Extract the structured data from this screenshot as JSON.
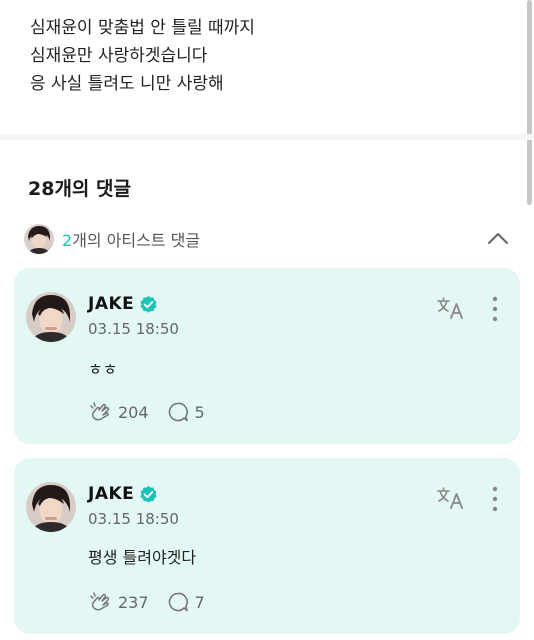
{
  "post": {
    "lines": [
      "심재윤이 맞춤법 안 틀릴 때까지",
      "심재윤만 사랑하겟습니다",
      "응 사실 틀려도 니만 사랑해"
    ]
  },
  "comments_header": {
    "count_label": "28개의 댓글"
  },
  "artist_comments": {
    "count": "2",
    "label_suffix": "개의 아티스트 댓글"
  },
  "comments": [
    {
      "author": "JAKE",
      "date": "03.15 18:50",
      "text": "ㅎㅎ",
      "likes": "204",
      "replies": "5"
    },
    {
      "author": "JAKE",
      "date": "03.15 18:50",
      "text": "평생 틀려야겟다",
      "likes": "237",
      "replies": "7"
    }
  ],
  "colors": {
    "accent": "#1ec0ba",
    "card_bg": "#e3f7f4"
  },
  "icons": {
    "verified": "verified-badge-icon",
    "translate": "translate-icon",
    "more": "more-vertical-icon",
    "like": "cheer-hand-icon",
    "reply": "speech-bubble-icon",
    "collapse": "chevron-up-icon"
  }
}
